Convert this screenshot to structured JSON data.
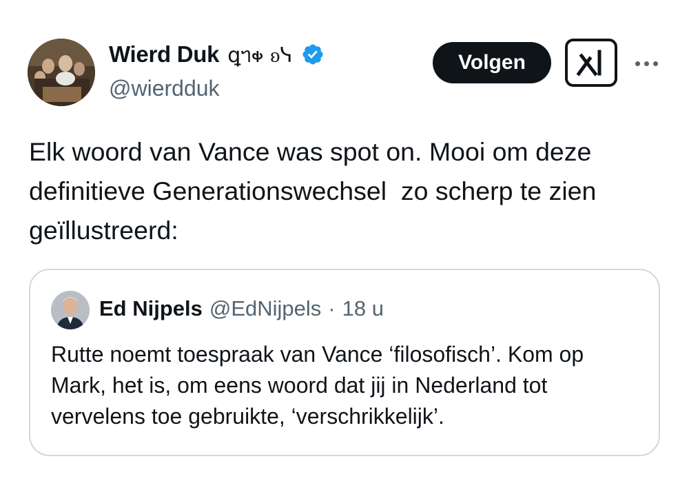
{
  "author": {
    "display_name": "Wierd Duk",
    "name_glyphs": "ꝗᥐ𐑉 ᦈᓭ",
    "handle": "@wierdduk",
    "verified": true
  },
  "actions": {
    "follow_label": "Volgen",
    "grok_icon": "grok-icon",
    "more_icon": "more-icon"
  },
  "tweet": {
    "text": "Elk woord van Vance was spot on. Mooi om deze\ndefinitieve Generationswechsel  zo scherp te zien\ngeïllustreerd:"
  },
  "quote": {
    "name": "Ed Nijpels",
    "handle": "@EdNijpels",
    "separator": "·",
    "time": "18 u",
    "text": "Rutte noemt toespraak van Vance ‘filosofisch’. Kom op Mark, het is, om eens woord dat jij in Nederland tot vervelens toe gebruikte, ‘verschrikkelijk’."
  },
  "colors": {
    "text": "#0f1419",
    "secondary": "#536471",
    "verified_blue": "#1d9bf0",
    "border": "#cfd9de"
  }
}
